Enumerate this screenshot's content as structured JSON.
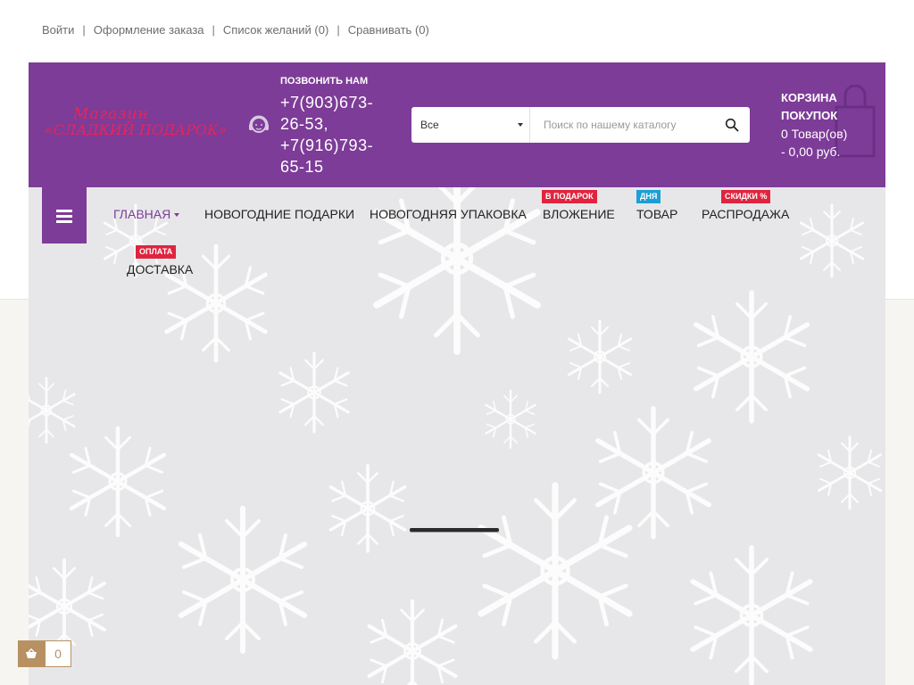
{
  "top_links": {
    "login": "Войти",
    "checkout": "Оформление заказа",
    "wishlist": "Список желаний (0)",
    "compare": "Сравнивать (0)",
    "separator": "|"
  },
  "logo": {
    "line1": "Магазин",
    "line2": "«СЛАДКИЙ ПОДАРОК»"
  },
  "contact": {
    "label": "ПОЗВОНИТЬ НАМ",
    "phones": "+7(903)673-26-53, +7(916)793-65-15",
    "icon": "headset-icon"
  },
  "search": {
    "category": "Все",
    "placeholder": "Поиск по нашему каталогу",
    "icon": "search-icon"
  },
  "cart": {
    "title": "КОРЗИНА ПОКУПОК",
    "count": "0 Товар(ов)",
    "total": "- 0,00 руб."
  },
  "nav": {
    "items": [
      {
        "label": "ГЛАВНАЯ",
        "badge": ""
      },
      {
        "label": "НОВОГОДНИЕ ПОДАРКИ",
        "badge": ""
      },
      {
        "label": "НОВОГОДНЯЯ УПАКОВКА",
        "badge": ""
      },
      {
        "label": "ВЛОЖЕНИЕ",
        "badge": "В ПОДАРОК"
      },
      {
        "label": "ТОВАР",
        "badge": "ДНЯ"
      },
      {
        "label": "РАСПРОДАЖА",
        "badge": "СКИДКИ %"
      },
      {
        "label": "ДОСТАВКА",
        "badge": "ОПЛАТА"
      }
    ]
  },
  "mini_cart": {
    "count": "0",
    "icon": "basket-icon"
  },
  "colors": {
    "brand": "#7d3c98",
    "badge_red": "#e0243f",
    "badge_blue": "#1c9fd6",
    "accent_gold": "#b89163"
  }
}
